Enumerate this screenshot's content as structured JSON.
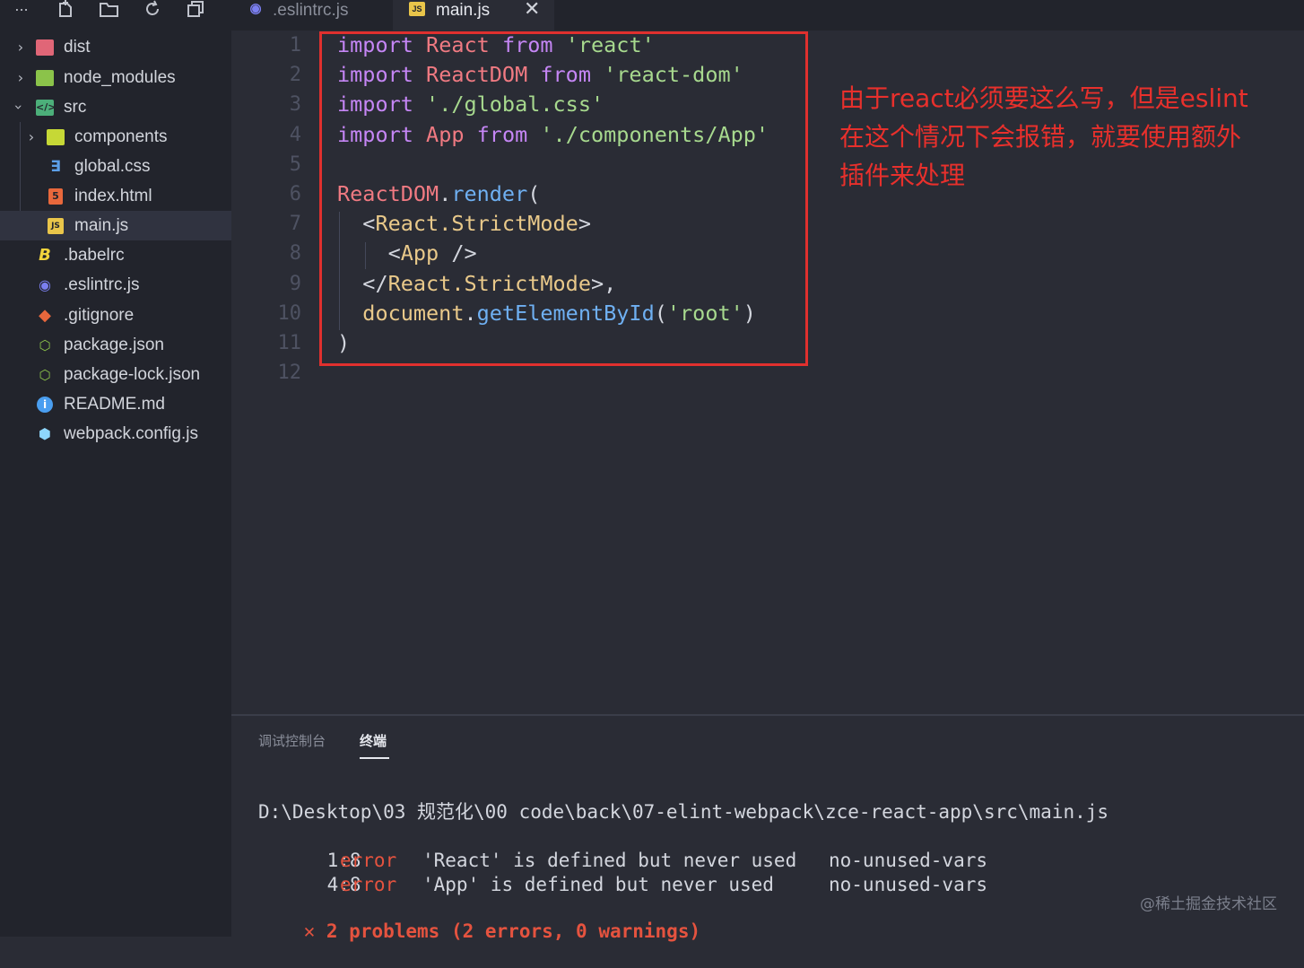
{
  "sidebar": {
    "more_label": "...",
    "toolbar_icons": [
      "new-file-icon",
      "new-folder-icon",
      "refresh-icon",
      "collapse-all-icon"
    ],
    "items": [
      {
        "label": "dist",
        "icon": "folder-dist-icon",
        "expanded": false
      },
      {
        "label": "node_modules",
        "icon": "folder-node-icon",
        "expanded": false
      },
      {
        "label": "src",
        "icon": "folder-src-icon",
        "expanded": true
      },
      {
        "label": "components",
        "icon": "folder-components-icon",
        "expanded": false
      },
      {
        "label": "global.css",
        "icon": "css-file-icon"
      },
      {
        "label": "index.html",
        "icon": "html-file-icon"
      },
      {
        "label": "main.js",
        "icon": "js-file-icon",
        "selected": true
      },
      {
        "label": ".babelrc",
        "icon": "babel-file-icon"
      },
      {
        "label": ".eslintrc.js",
        "icon": "eslint-file-icon"
      },
      {
        "label": ".gitignore",
        "icon": "git-file-icon"
      },
      {
        "label": "package.json",
        "icon": "nodejs-file-icon"
      },
      {
        "label": "package-lock.json",
        "icon": "nodejs-file-icon"
      },
      {
        "label": "README.md",
        "icon": "info-file-icon"
      },
      {
        "label": "webpack.config.js",
        "icon": "webpack-file-icon"
      }
    ]
  },
  "tabs": [
    {
      "label": ".eslintrc.js",
      "active": false,
      "icon": "eslint-file-icon"
    },
    {
      "label": "main.js",
      "active": true,
      "icon": "js-file-icon",
      "close": "✕"
    }
  ],
  "editor": {
    "line_numbers": [
      "1",
      "2",
      "3",
      "4",
      "5",
      "6",
      "7",
      "8",
      "9",
      "10",
      "11",
      "12"
    ],
    "lines": [
      [
        {
          "t": "import",
          "c": "kw"
        },
        {
          "t": " ",
          "c": "pl"
        },
        {
          "t": "React",
          "c": "id"
        },
        {
          "t": " ",
          "c": "pl"
        },
        {
          "t": "from",
          "c": "kw"
        },
        {
          "t": " ",
          "c": "pl"
        },
        {
          "t": "'react'",
          "c": "str"
        }
      ],
      [
        {
          "t": "import",
          "c": "kw"
        },
        {
          "t": " ",
          "c": "pl"
        },
        {
          "t": "ReactDOM",
          "c": "id"
        },
        {
          "t": " ",
          "c": "pl"
        },
        {
          "t": "from",
          "c": "kw"
        },
        {
          "t": " ",
          "c": "pl"
        },
        {
          "t": "'react-dom'",
          "c": "str"
        }
      ],
      [
        {
          "t": "import",
          "c": "kw"
        },
        {
          "t": " ",
          "c": "pl"
        },
        {
          "t": "'./global.css'",
          "c": "str"
        }
      ],
      [
        {
          "t": "import",
          "c": "kw"
        },
        {
          "t": " ",
          "c": "pl"
        },
        {
          "t": "App",
          "c": "id"
        },
        {
          "t": " ",
          "c": "pl"
        },
        {
          "t": "from",
          "c": "kw"
        },
        {
          "t": " ",
          "c": "pl"
        },
        {
          "t": "'./components/App'",
          "c": "str"
        }
      ],
      [],
      [
        {
          "t": "ReactDOM",
          "c": "id"
        },
        {
          "t": ".",
          "c": "pl"
        },
        {
          "t": "render",
          "c": "fn"
        },
        {
          "t": "(",
          "c": "pl"
        }
      ],
      [
        {
          "t": "  ",
          "c": "pl"
        },
        {
          "t": "<",
          "c": "pl"
        },
        {
          "t": "React.StrictMode",
          "c": "tg"
        },
        {
          "t": ">",
          "c": "pl"
        }
      ],
      [
        {
          "t": "    ",
          "c": "pl"
        },
        {
          "t": "<",
          "c": "pl"
        },
        {
          "t": "App",
          "c": "tg"
        },
        {
          "t": " />",
          "c": "pl"
        }
      ],
      [
        {
          "t": "  ",
          "c": "pl"
        },
        {
          "t": "</",
          "c": "pl"
        },
        {
          "t": "React.StrictMode",
          "c": "tg"
        },
        {
          "t": ">,",
          "c": "pl"
        }
      ],
      [
        {
          "t": "  ",
          "c": "pl"
        },
        {
          "t": "document",
          "c": "tg"
        },
        {
          "t": ".",
          "c": "pl"
        },
        {
          "t": "getElementById",
          "c": "fn"
        },
        {
          "t": "(",
          "c": "pl"
        },
        {
          "t": "'root'",
          "c": "str"
        },
        {
          "t": ")",
          "c": "pl"
        }
      ],
      [
        {
          "t": ")",
          "c": "pl"
        }
      ],
      []
    ]
  },
  "annotation": {
    "line1": "由于react必须要这么写，但是eslint",
    "line2": "在这个情况下会报错，就要使用额外",
    "line3": "插件来处理"
  },
  "panel": {
    "tab_debug": "调试控制台",
    "tab_terminal": "终端",
    "path": "D:\\Desktop\\03 规范化\\00 code\\back\\07-elint-webpack\\zce-react-app\\src\\main.js",
    "errors": [
      {
        "pos": "1:8",
        "level": "error",
        "message": "'React' is defined but never used",
        "rule": "no-unused-vars"
      },
      {
        "pos": "4:8",
        "level": "error",
        "message": "'App' is defined but never used",
        "rule": "no-unused-vars"
      }
    ],
    "summary_icon": "✕",
    "summary": "2 problems (2 errors, 0 warnings)"
  },
  "watermark": "@稀土掘金技术社区",
  "colors": {
    "highlight_box": "#e0302e",
    "annotation": "#e8302c",
    "error": "#e5533f"
  }
}
